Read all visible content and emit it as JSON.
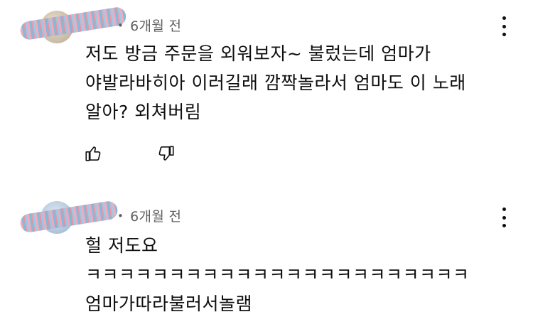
{
  "comments": [
    {
      "author": "",
      "time": "6개월 전",
      "lines": [
        "저도 방금 주문을 외워보자~ 불렀는데 엄마가",
        "야발라바히아 이러길래 깜짝놀라서 엄마도 이 노래",
        "알아? 외쳐버림"
      ]
    },
    {
      "author": "",
      "time": "6개월 전",
      "lines": [
        "헐 저도요",
        "ㅋㅋㅋㅋㅋㅋㅋㅋㅋㅋㅋㅋㅋㅋㅋㅋㅋㅋㅋㅋㅋㅋㅋ",
        "엄마가따라불러서놀램"
      ]
    }
  ],
  "icons": {
    "like": "thumb-up-icon",
    "dislike": "thumb-down-icon",
    "more": "more-vertical-icon"
  }
}
